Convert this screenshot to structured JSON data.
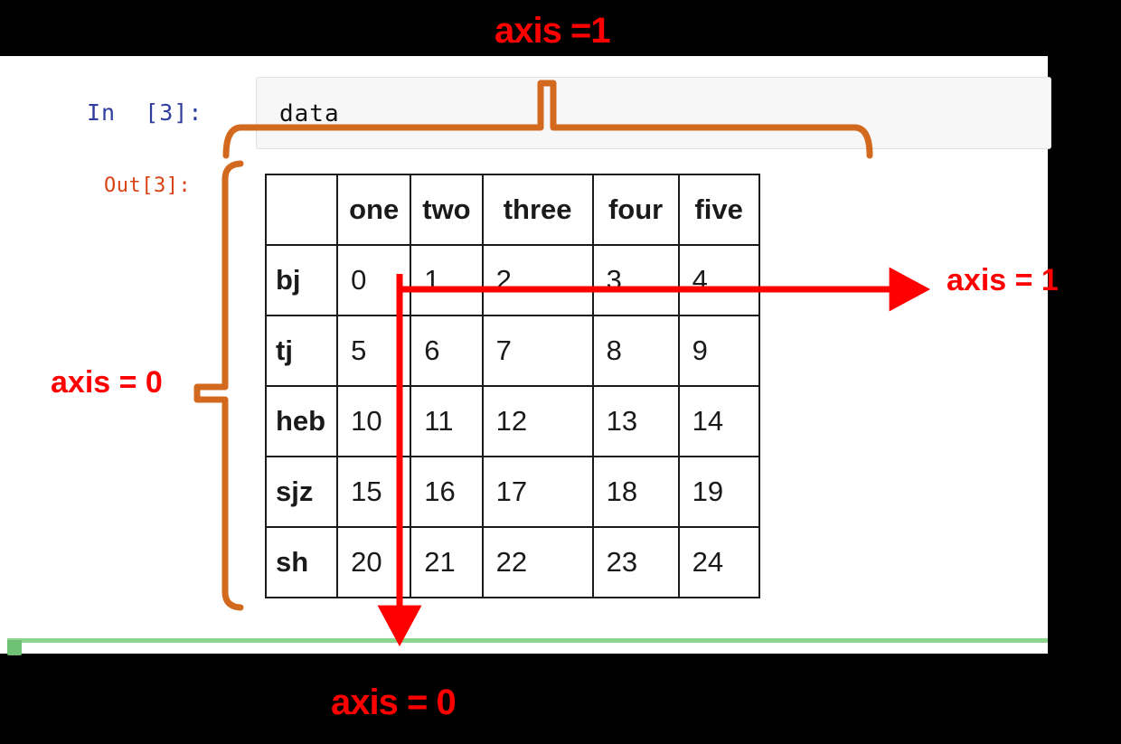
{
  "notebook": {
    "in_prompt": "In  [3]:",
    "out_prompt": "Out[3]:",
    "code": "data"
  },
  "table": {
    "corner": "",
    "columns": [
      "one",
      "two",
      "three",
      "four",
      "five"
    ],
    "rows": [
      {
        "index": "bj",
        "cells": [
          "0",
          "1",
          "2",
          "3",
          "4"
        ]
      },
      {
        "index": "tj",
        "cells": [
          "5",
          "6",
          "7",
          "8",
          "9"
        ]
      },
      {
        "index": "heb",
        "cells": [
          "10",
          "11",
          "12",
          "13",
          "14"
        ]
      },
      {
        "index": "sjz",
        "cells": [
          "15",
          "16",
          "17",
          "18",
          "19"
        ]
      },
      {
        "index": "sh",
        "cells": [
          "20",
          "21",
          "22",
          "23",
          "24"
        ]
      }
    ]
  },
  "annotations": {
    "axis1_top": "axis =1",
    "axis1_right": "axis = 1",
    "axis0_left": "axis = 0",
    "axis0_bottom": "axis = 0"
  },
  "colors": {
    "red": "#ff0000",
    "orange": "#d2691e",
    "green": "#6ec072",
    "in_prompt": "#303f9f",
    "out_prompt": "#d84315",
    "cell_bg": "#f7f7f7",
    "table_border": "#1a1a1a",
    "page_bg": "#000000",
    "canvas_bg": "#ffffff"
  }
}
